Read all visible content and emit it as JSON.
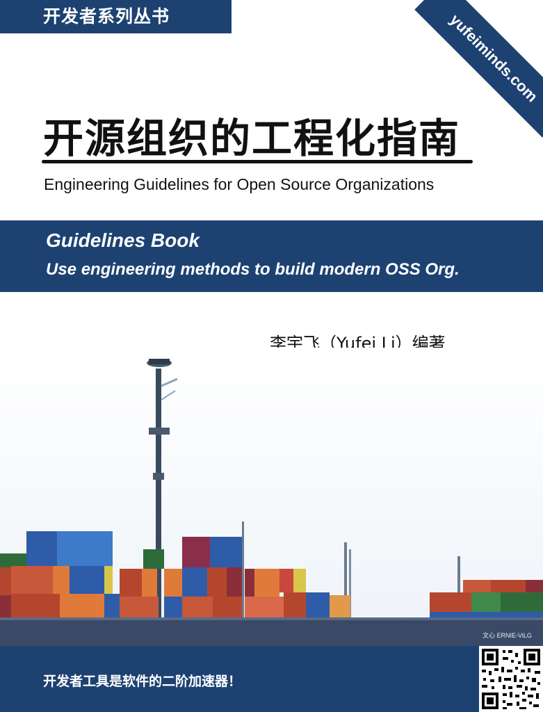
{
  "series": {
    "label": "开发者系列丛书"
  },
  "ribbon": {
    "url": "yufeiminds.com"
  },
  "title": {
    "main": "开源组织的工程化指南",
    "english": "Engineering Guidelines for Open Source Organizations"
  },
  "band": {
    "line1": "Guidelines Book",
    "line2": "Use engineering methods to build modern OSS Org."
  },
  "author": {
    "text": "李宇飞（Yufei Li）编著"
  },
  "image": {
    "watermark": "文心 ERNIE-ViLG"
  },
  "footer": {
    "slogan": "开发者工具是软件的二阶加速器！"
  },
  "colors": {
    "brand_blue": "#1d4272",
    "text_dark": "#111111",
    "background": "#ffffff"
  }
}
